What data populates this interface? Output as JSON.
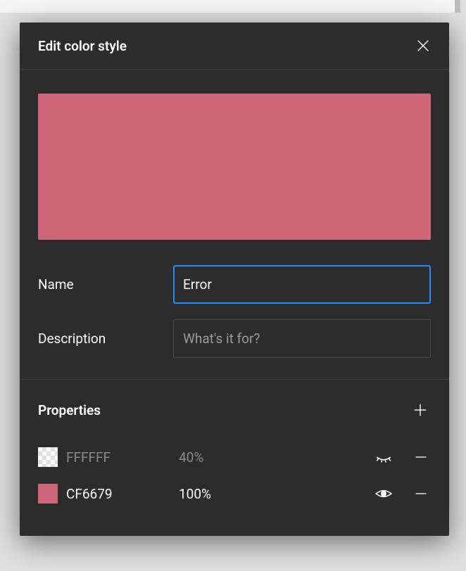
{
  "modal": {
    "title": "Edit color style",
    "preview_color": "#CF6679",
    "fields": {
      "name_label": "Name",
      "name_value": "Error",
      "description_label": "Description",
      "description_placeholder": "What's it for?",
      "description_value": ""
    }
  },
  "properties": {
    "title": "Properties",
    "rows": [
      {
        "hex": "FFFFFF",
        "opacity": "40%",
        "visible": false,
        "swatch_color": "#FFFFFF"
      },
      {
        "hex": "CF6679",
        "opacity": "100%",
        "visible": true,
        "swatch_color": "#CF6679"
      }
    ]
  }
}
